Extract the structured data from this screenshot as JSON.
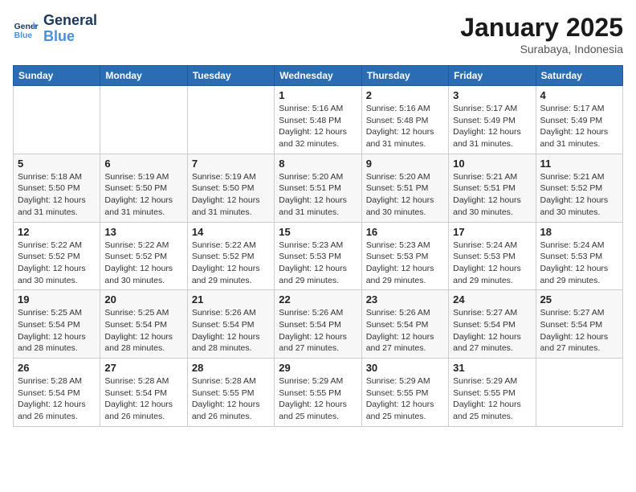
{
  "logo": {
    "line1": "General",
    "line2": "Blue"
  },
  "title": "January 2025",
  "subtitle": "Surabaya, Indonesia",
  "weekdays": [
    "Sunday",
    "Monday",
    "Tuesday",
    "Wednesday",
    "Thursday",
    "Friday",
    "Saturday"
  ],
  "weeks": [
    [
      {
        "day": "",
        "info": ""
      },
      {
        "day": "",
        "info": ""
      },
      {
        "day": "",
        "info": ""
      },
      {
        "day": "1",
        "info": "Sunrise: 5:16 AM\nSunset: 5:48 PM\nDaylight: 12 hours\nand 32 minutes."
      },
      {
        "day": "2",
        "info": "Sunrise: 5:16 AM\nSunset: 5:48 PM\nDaylight: 12 hours\nand 31 minutes."
      },
      {
        "day": "3",
        "info": "Sunrise: 5:17 AM\nSunset: 5:49 PM\nDaylight: 12 hours\nand 31 minutes."
      },
      {
        "day": "4",
        "info": "Sunrise: 5:17 AM\nSunset: 5:49 PM\nDaylight: 12 hours\nand 31 minutes."
      }
    ],
    [
      {
        "day": "5",
        "info": "Sunrise: 5:18 AM\nSunset: 5:50 PM\nDaylight: 12 hours\nand 31 minutes."
      },
      {
        "day": "6",
        "info": "Sunrise: 5:19 AM\nSunset: 5:50 PM\nDaylight: 12 hours\nand 31 minutes."
      },
      {
        "day": "7",
        "info": "Sunrise: 5:19 AM\nSunset: 5:50 PM\nDaylight: 12 hours\nand 31 minutes."
      },
      {
        "day": "8",
        "info": "Sunrise: 5:20 AM\nSunset: 5:51 PM\nDaylight: 12 hours\nand 31 minutes."
      },
      {
        "day": "9",
        "info": "Sunrise: 5:20 AM\nSunset: 5:51 PM\nDaylight: 12 hours\nand 30 minutes."
      },
      {
        "day": "10",
        "info": "Sunrise: 5:21 AM\nSunset: 5:51 PM\nDaylight: 12 hours\nand 30 minutes."
      },
      {
        "day": "11",
        "info": "Sunrise: 5:21 AM\nSunset: 5:52 PM\nDaylight: 12 hours\nand 30 minutes."
      }
    ],
    [
      {
        "day": "12",
        "info": "Sunrise: 5:22 AM\nSunset: 5:52 PM\nDaylight: 12 hours\nand 30 minutes."
      },
      {
        "day": "13",
        "info": "Sunrise: 5:22 AM\nSunset: 5:52 PM\nDaylight: 12 hours\nand 30 minutes."
      },
      {
        "day": "14",
        "info": "Sunrise: 5:22 AM\nSunset: 5:52 PM\nDaylight: 12 hours\nand 29 minutes."
      },
      {
        "day": "15",
        "info": "Sunrise: 5:23 AM\nSunset: 5:53 PM\nDaylight: 12 hours\nand 29 minutes."
      },
      {
        "day": "16",
        "info": "Sunrise: 5:23 AM\nSunset: 5:53 PM\nDaylight: 12 hours\nand 29 minutes."
      },
      {
        "day": "17",
        "info": "Sunrise: 5:24 AM\nSunset: 5:53 PM\nDaylight: 12 hours\nand 29 minutes."
      },
      {
        "day": "18",
        "info": "Sunrise: 5:24 AM\nSunset: 5:53 PM\nDaylight: 12 hours\nand 29 minutes."
      }
    ],
    [
      {
        "day": "19",
        "info": "Sunrise: 5:25 AM\nSunset: 5:54 PM\nDaylight: 12 hours\nand 28 minutes."
      },
      {
        "day": "20",
        "info": "Sunrise: 5:25 AM\nSunset: 5:54 PM\nDaylight: 12 hours\nand 28 minutes."
      },
      {
        "day": "21",
        "info": "Sunrise: 5:26 AM\nSunset: 5:54 PM\nDaylight: 12 hours\nand 28 minutes."
      },
      {
        "day": "22",
        "info": "Sunrise: 5:26 AM\nSunset: 5:54 PM\nDaylight: 12 hours\nand 27 minutes."
      },
      {
        "day": "23",
        "info": "Sunrise: 5:26 AM\nSunset: 5:54 PM\nDaylight: 12 hours\nand 27 minutes."
      },
      {
        "day": "24",
        "info": "Sunrise: 5:27 AM\nSunset: 5:54 PM\nDaylight: 12 hours\nand 27 minutes."
      },
      {
        "day": "25",
        "info": "Sunrise: 5:27 AM\nSunset: 5:54 PM\nDaylight: 12 hours\nand 27 minutes."
      }
    ],
    [
      {
        "day": "26",
        "info": "Sunrise: 5:28 AM\nSunset: 5:54 PM\nDaylight: 12 hours\nand 26 minutes."
      },
      {
        "day": "27",
        "info": "Sunrise: 5:28 AM\nSunset: 5:54 PM\nDaylight: 12 hours\nand 26 minutes."
      },
      {
        "day": "28",
        "info": "Sunrise: 5:28 AM\nSunset: 5:55 PM\nDaylight: 12 hours\nand 26 minutes."
      },
      {
        "day": "29",
        "info": "Sunrise: 5:29 AM\nSunset: 5:55 PM\nDaylight: 12 hours\nand 25 minutes."
      },
      {
        "day": "30",
        "info": "Sunrise: 5:29 AM\nSunset: 5:55 PM\nDaylight: 12 hours\nand 25 minutes."
      },
      {
        "day": "31",
        "info": "Sunrise: 5:29 AM\nSunset: 5:55 PM\nDaylight: 12 hours\nand 25 minutes."
      },
      {
        "day": "",
        "info": ""
      }
    ]
  ]
}
